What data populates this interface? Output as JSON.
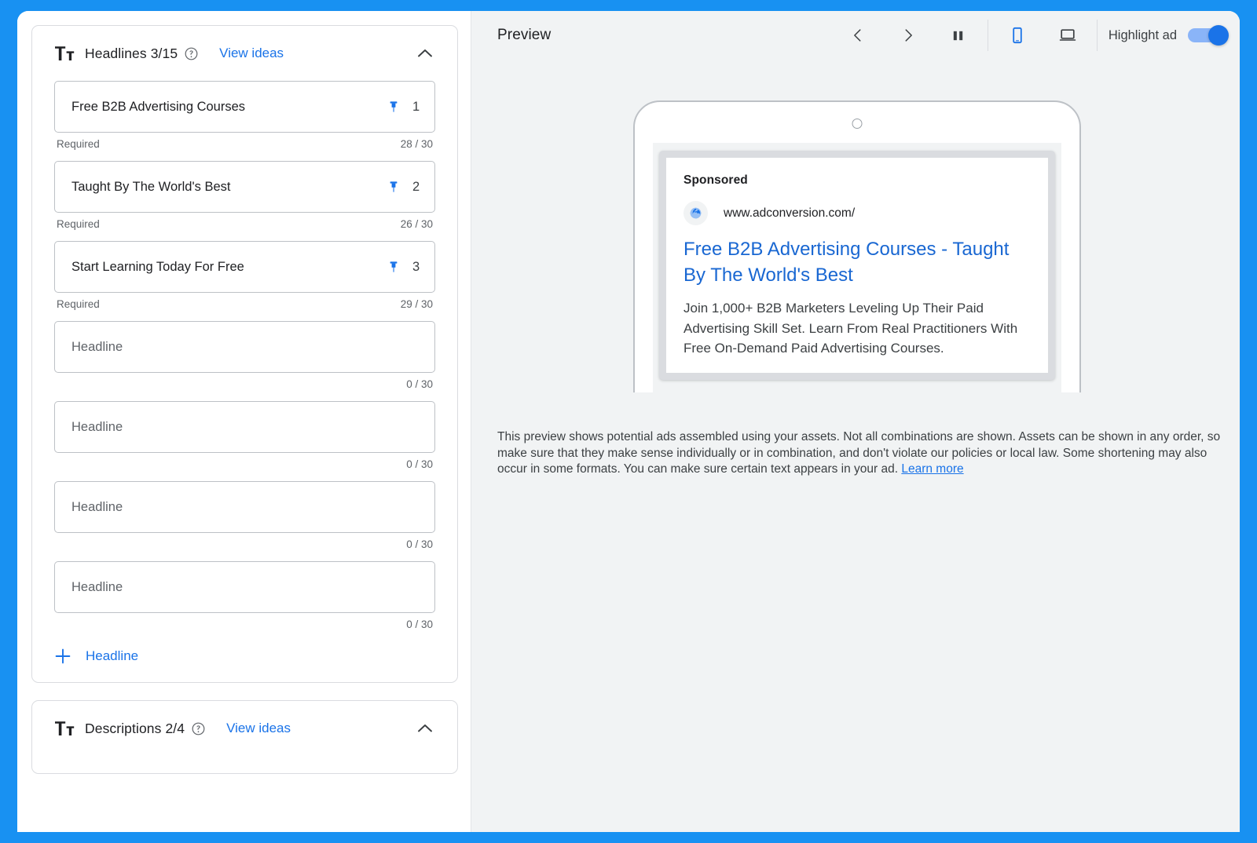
{
  "theme": {
    "accent": "#1a73e8",
    "window_border": "#1891f2",
    "panel_bg": "#f1f3f4"
  },
  "headlines_section": {
    "icon": "text-format-icon",
    "title": "Headlines 3/15",
    "help_icon": "help-circle-icon",
    "view_ideas_label": "View ideas",
    "collapse_icon": "chevron-up-icon",
    "fields": [
      {
        "value": "Free B2B Advertising Courses",
        "placeholder": "Headline",
        "pinned": true,
        "pin_position": "1",
        "required_label": "Required",
        "counter": "28 / 30"
      },
      {
        "value": "Taught By The World's Best",
        "placeholder": "Headline",
        "pinned": true,
        "pin_position": "2",
        "required_label": "Required",
        "counter": "26 / 30"
      },
      {
        "value": "Start Learning Today For Free",
        "placeholder": "Headline",
        "pinned": true,
        "pin_position": "3",
        "required_label": "Required",
        "counter": "29 / 30"
      },
      {
        "value": "",
        "placeholder": "Headline",
        "pinned": false,
        "pin_position": "",
        "required_label": "",
        "counter": "0 / 30"
      },
      {
        "value": "",
        "placeholder": "Headline",
        "pinned": false,
        "pin_position": "",
        "required_label": "",
        "counter": "0 / 30"
      },
      {
        "value": "",
        "placeholder": "Headline",
        "pinned": false,
        "pin_position": "",
        "required_label": "",
        "counter": "0 / 30"
      },
      {
        "value": "",
        "placeholder": "Headline",
        "pinned": false,
        "pin_position": "",
        "required_label": "",
        "counter": "0 / 30"
      }
    ],
    "add_icon": "plus-icon",
    "add_label": "Headline"
  },
  "descriptions_section": {
    "icon": "text-format-icon",
    "title": "Descriptions 2/4",
    "help_icon": "help-circle-icon",
    "view_ideas_label": "View ideas",
    "collapse_icon": "chevron-up-icon"
  },
  "preview": {
    "title": "Preview",
    "prev_icon": "chevron-left-icon",
    "next_icon": "chevron-right-icon",
    "split_icon": "split-columns-icon",
    "mobile_icon": "mobile-device-icon",
    "desktop_icon": "desktop-device-icon",
    "active_device": "mobile",
    "highlight_label": "Highlight ad",
    "highlight_on": true,
    "ad": {
      "sponsored_label": "Sponsored",
      "favicon": "globe-icon",
      "url": "www.adconversion.com/",
      "headline": "Free B2B Advertising Courses - Taught By The World's Best",
      "description": "Join 1,000+ B2B Marketers Leveling Up Their Paid Advertising Skill Set. Learn From Real Practitioners With Free On-Demand Paid Advertising Courses."
    },
    "note": "This preview shows potential ads assembled using your assets. Not all combinations are shown. Assets can be shown in any order, so make sure that they make sense individually or in combination, and don't violate our policies or local law. Some shortening may also occur in some formats. You can make sure certain text appears in your ad. ",
    "note_link": "Learn more"
  }
}
